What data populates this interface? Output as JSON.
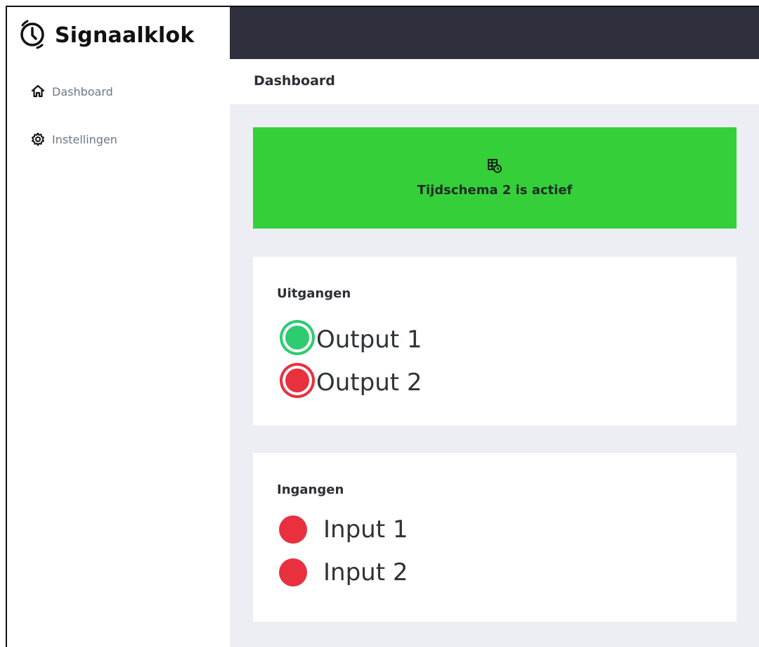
{
  "sidebar": {
    "logo_text": "Signaalklok",
    "items": [
      {
        "label": "Dashboard",
        "icon": "home-icon"
      },
      {
        "label": "Instellingen",
        "icon": "gear-icon"
      }
    ]
  },
  "header": {
    "title": "Dashboard"
  },
  "banner": {
    "icon": "schedule-icon",
    "text": "Tijdschema 2 is actief",
    "color": "#35cf3a"
  },
  "outputs": {
    "title": "Uitgangen",
    "items": [
      {
        "label": "Output 1",
        "state": "on",
        "color": "#2ecc71"
      },
      {
        "label": "Output 2",
        "state": "off",
        "color": "#e8303f"
      }
    ]
  },
  "inputs": {
    "title": "Ingangen",
    "items": [
      {
        "label": "Input 1",
        "color": "#e8303f"
      },
      {
        "label": "Input 2",
        "color": "#e8303f"
      }
    ]
  },
  "colors": {
    "topbar": "#2f303d",
    "content_bg": "#eceef3",
    "nav_text": "#6e7784"
  }
}
